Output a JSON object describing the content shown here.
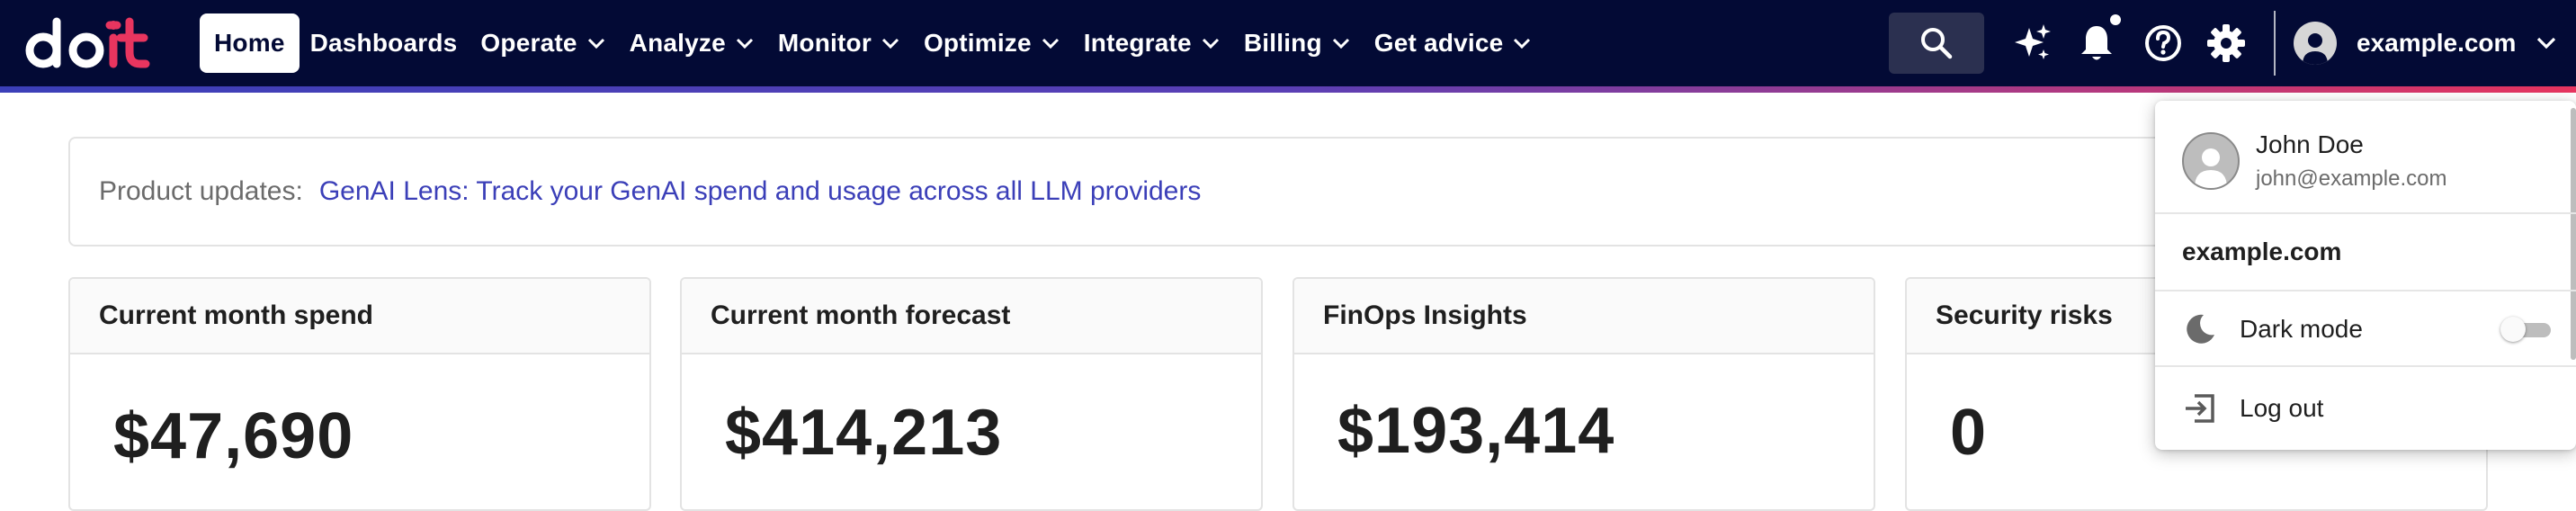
{
  "brand": {
    "logo_text": "doit",
    "icon": "doit-logo",
    "accent": "#e8355f",
    "nav_bg": "#030a35"
  },
  "nav": {
    "items": [
      {
        "label": "Home",
        "active": true,
        "has_dropdown": false
      },
      {
        "label": "Dashboards",
        "active": false,
        "has_dropdown": false
      },
      {
        "label": "Operate",
        "active": false,
        "has_dropdown": true
      },
      {
        "label": "Analyze",
        "active": false,
        "has_dropdown": true
      },
      {
        "label": "Monitor",
        "active": false,
        "has_dropdown": true
      },
      {
        "label": "Optimize",
        "active": false,
        "has_dropdown": true
      },
      {
        "label": "Integrate",
        "active": false,
        "has_dropdown": true
      },
      {
        "label": "Billing",
        "active": false,
        "has_dropdown": true
      },
      {
        "label": "Get advice",
        "active": false,
        "has_dropdown": true
      }
    ]
  },
  "toolbar": {
    "icons": [
      "search-icon",
      "sparkle-icon",
      "bell-icon",
      "help-icon",
      "gear-icon"
    ],
    "notification_dot": true,
    "account_label": "example.com"
  },
  "updates": {
    "label": "Product updates:",
    "link_text": "GenAI Lens: Track your GenAI spend and usage across all LLM providers",
    "link_color": "#3b3fb8"
  },
  "cards": [
    {
      "title": "Current month spend",
      "value": "$47,690"
    },
    {
      "title": "Current month forecast",
      "value": "$414,213"
    },
    {
      "title": "FinOps Insights",
      "value": "$193,414"
    },
    {
      "title": "Security risks",
      "value": "0"
    }
  ],
  "account_menu": {
    "user_name": "John Doe",
    "user_email": "john@example.com",
    "domain": "example.com",
    "dark_mode_label": "Dark mode",
    "dark_mode_enabled": false,
    "logout_label": "Log out"
  }
}
